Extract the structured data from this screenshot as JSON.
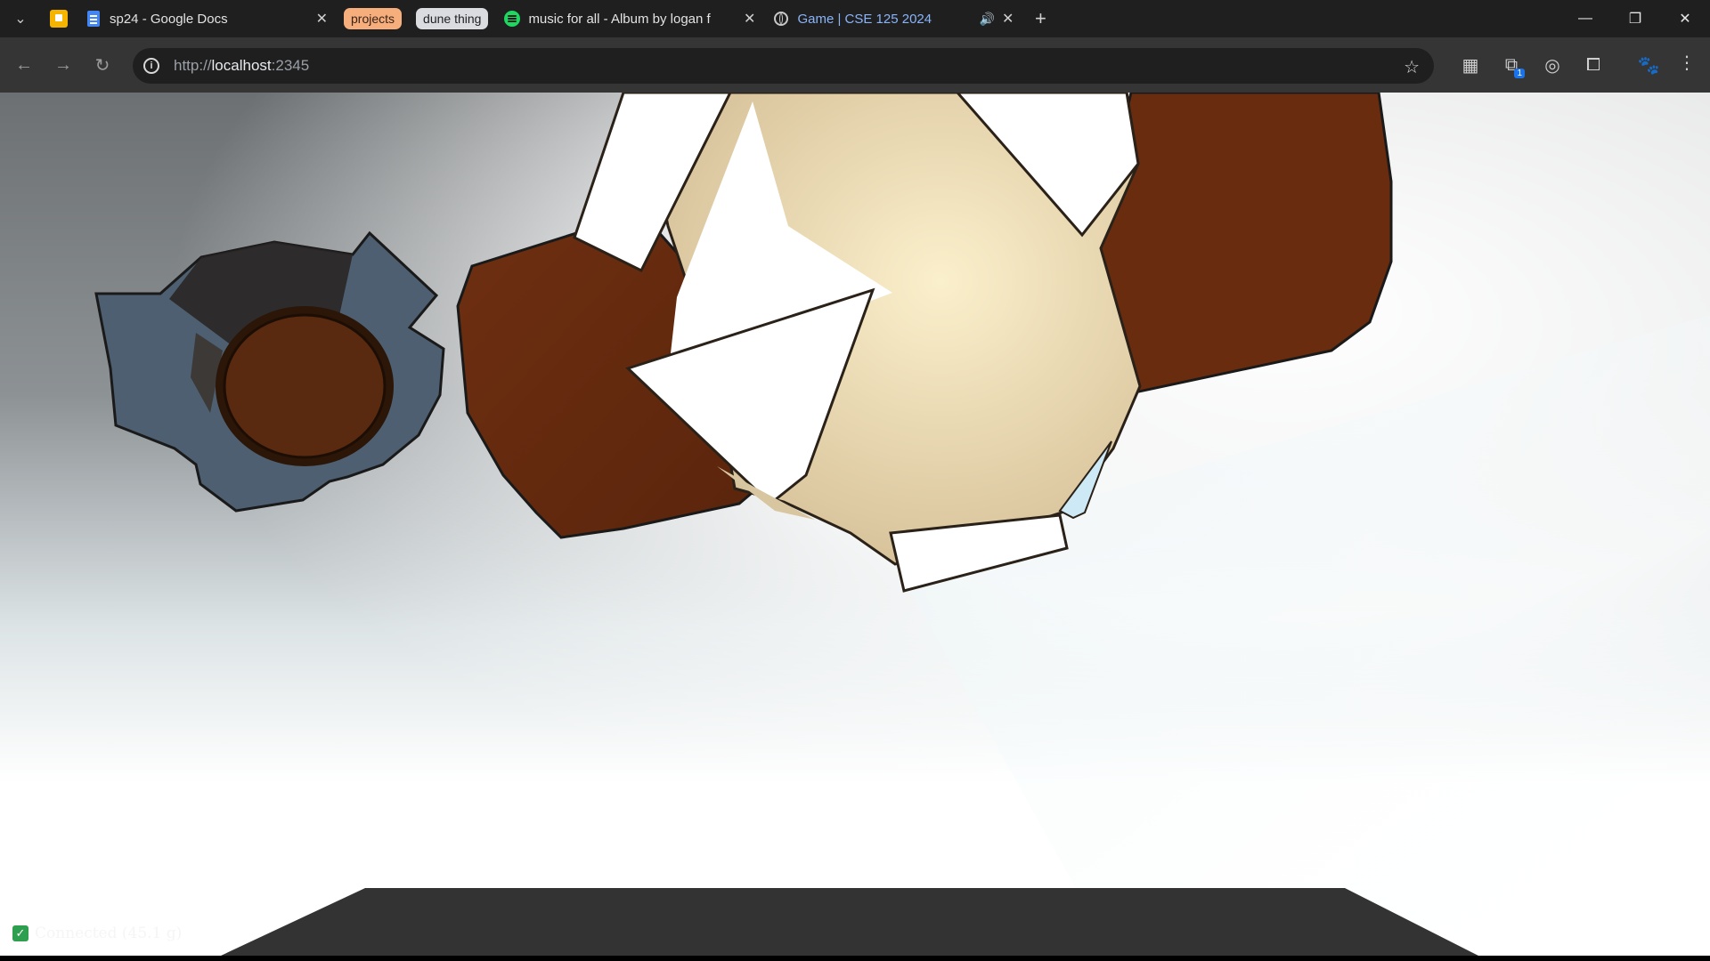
{
  "browser": {
    "tab_search_icon": "chevron-down-icon",
    "pinned_tab": {
      "icon": "keep-notes-icon",
      "color": "#f4b400"
    },
    "tabs": [
      {
        "title": "sp24 - Google Docs",
        "icon": "docs-icon",
        "close": "✕"
      },
      {
        "title": "music for all - Album by logan f",
        "icon": "spotify-icon",
        "close": "✕"
      },
      {
        "title": "Game | CSE 125 2024",
        "icon": "globe-icon",
        "close": "✕",
        "audio": "🔊"
      }
    ],
    "tab_groups": [
      {
        "label": "projects",
        "color": "#f6ae7d"
      },
      {
        "label": "dune thing",
        "color": "#dadce0"
      }
    ],
    "new_tab": "+",
    "window_controls": {
      "minimize": "—",
      "restore": "❐",
      "close": "✕"
    },
    "address": {
      "scheme": "http://",
      "host": "localhost",
      "port": ":2345"
    },
    "nav": {
      "back": "←",
      "forward": "→",
      "reload": "↻"
    },
    "bookmark_star": "☆",
    "extensions": [
      {
        "icon": "grid-icon",
        "glyph": "▦"
      },
      {
        "icon": "extension-badge-icon",
        "glyph": "⧉",
        "badge": "1"
      },
      {
        "icon": "glasses-icon",
        "glyph": "◎"
      },
      {
        "icon": "puzzle-icon",
        "glyph": "⧠"
      },
      {
        "icon": "profile-avatar-icon",
        "glyph": "🐾"
      }
    ],
    "menu": "⋮"
  },
  "game": {
    "status_check": "✓",
    "status_text": "Connected (45.1       g)",
    "colors": {
      "brown": "#6b2d10",
      "cream": "#f1deae",
      "slate": "#4d5f70",
      "floor": "#333333"
    }
  }
}
